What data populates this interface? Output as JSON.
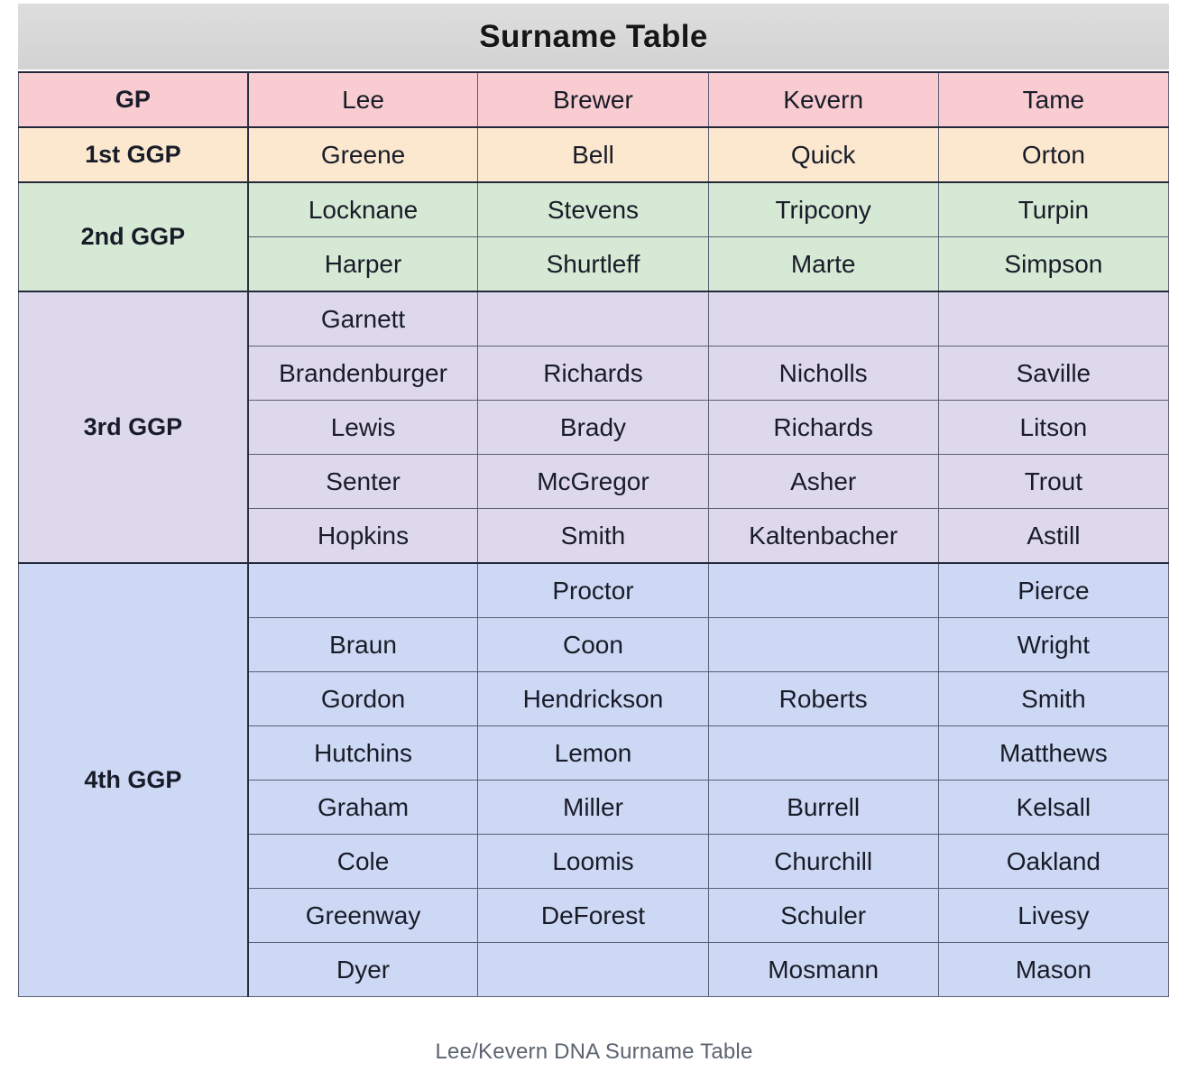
{
  "header": {
    "title": "Surname Table"
  },
  "caption": "Lee/Kevern DNA Surname Table",
  "colors": {
    "title_bar": "#d8d8d8",
    "gp": "#f8ccd0",
    "ggp1": "#fbe8cf",
    "ggp2": "#d6e9d5",
    "ggp3": "#ded8ec",
    "ggp4": "#cdd8f4",
    "border": "#5a5f73",
    "band_border": "#23283a",
    "text": "#181c28",
    "caption_text": "#5b6470"
  },
  "table": {
    "columns": [
      "Lee",
      "Brewer",
      "Kevern",
      "Tame"
    ],
    "generations": [
      {
        "label": "GP",
        "color_key": "gp",
        "rows": [
          [
            "Lee",
            "Brewer",
            "Kevern",
            "Tame"
          ]
        ]
      },
      {
        "label": "1st GGP",
        "color_key": "ggp1",
        "rows": [
          [
            "Greene",
            "Bell",
            "Quick",
            "Orton"
          ]
        ]
      },
      {
        "label": "2nd GGP",
        "color_key": "ggp2",
        "rows": [
          [
            "Locknane",
            "Stevens",
            "Tripcony",
            "Turpin"
          ],
          [
            "Harper",
            "Shurtleff",
            "Marte",
            "Simpson"
          ]
        ]
      },
      {
        "label": "3rd GGP",
        "color_key": "ggp3",
        "rows": [
          [
            "Garnett",
            "",
            "",
            ""
          ],
          [
            "Brandenburger",
            "Richards",
            "Nicholls",
            "Saville"
          ],
          [
            "Lewis",
            "Brady",
            "Richards",
            "Litson"
          ],
          [
            "Senter",
            "McGregor",
            "Asher",
            "Trout"
          ],
          [
            "Hopkins",
            "Smith",
            "Kaltenbacher",
            "Astill"
          ]
        ]
      },
      {
        "label": "4th GGP",
        "color_key": "ggp4",
        "rows": [
          [
            "",
            "Proctor",
            "",
            "Pierce"
          ],
          [
            "Braun",
            "Coon",
            "",
            "Wright"
          ],
          [
            "Gordon",
            "Hendrickson",
            "Roberts",
            "Smith"
          ],
          [
            "Hutchins",
            "Lemon",
            "",
            "Matthews"
          ],
          [
            "Graham",
            "Miller",
            "Burrell",
            "Kelsall"
          ],
          [
            "Cole",
            "Loomis",
            "Churchill",
            "Oakland"
          ],
          [
            "Greenway",
            "DeForest",
            "Schuler",
            "Livesy"
          ],
          [
            "Dyer",
            "",
            "Mosmann",
            "Mason"
          ]
        ]
      }
    ]
  }
}
